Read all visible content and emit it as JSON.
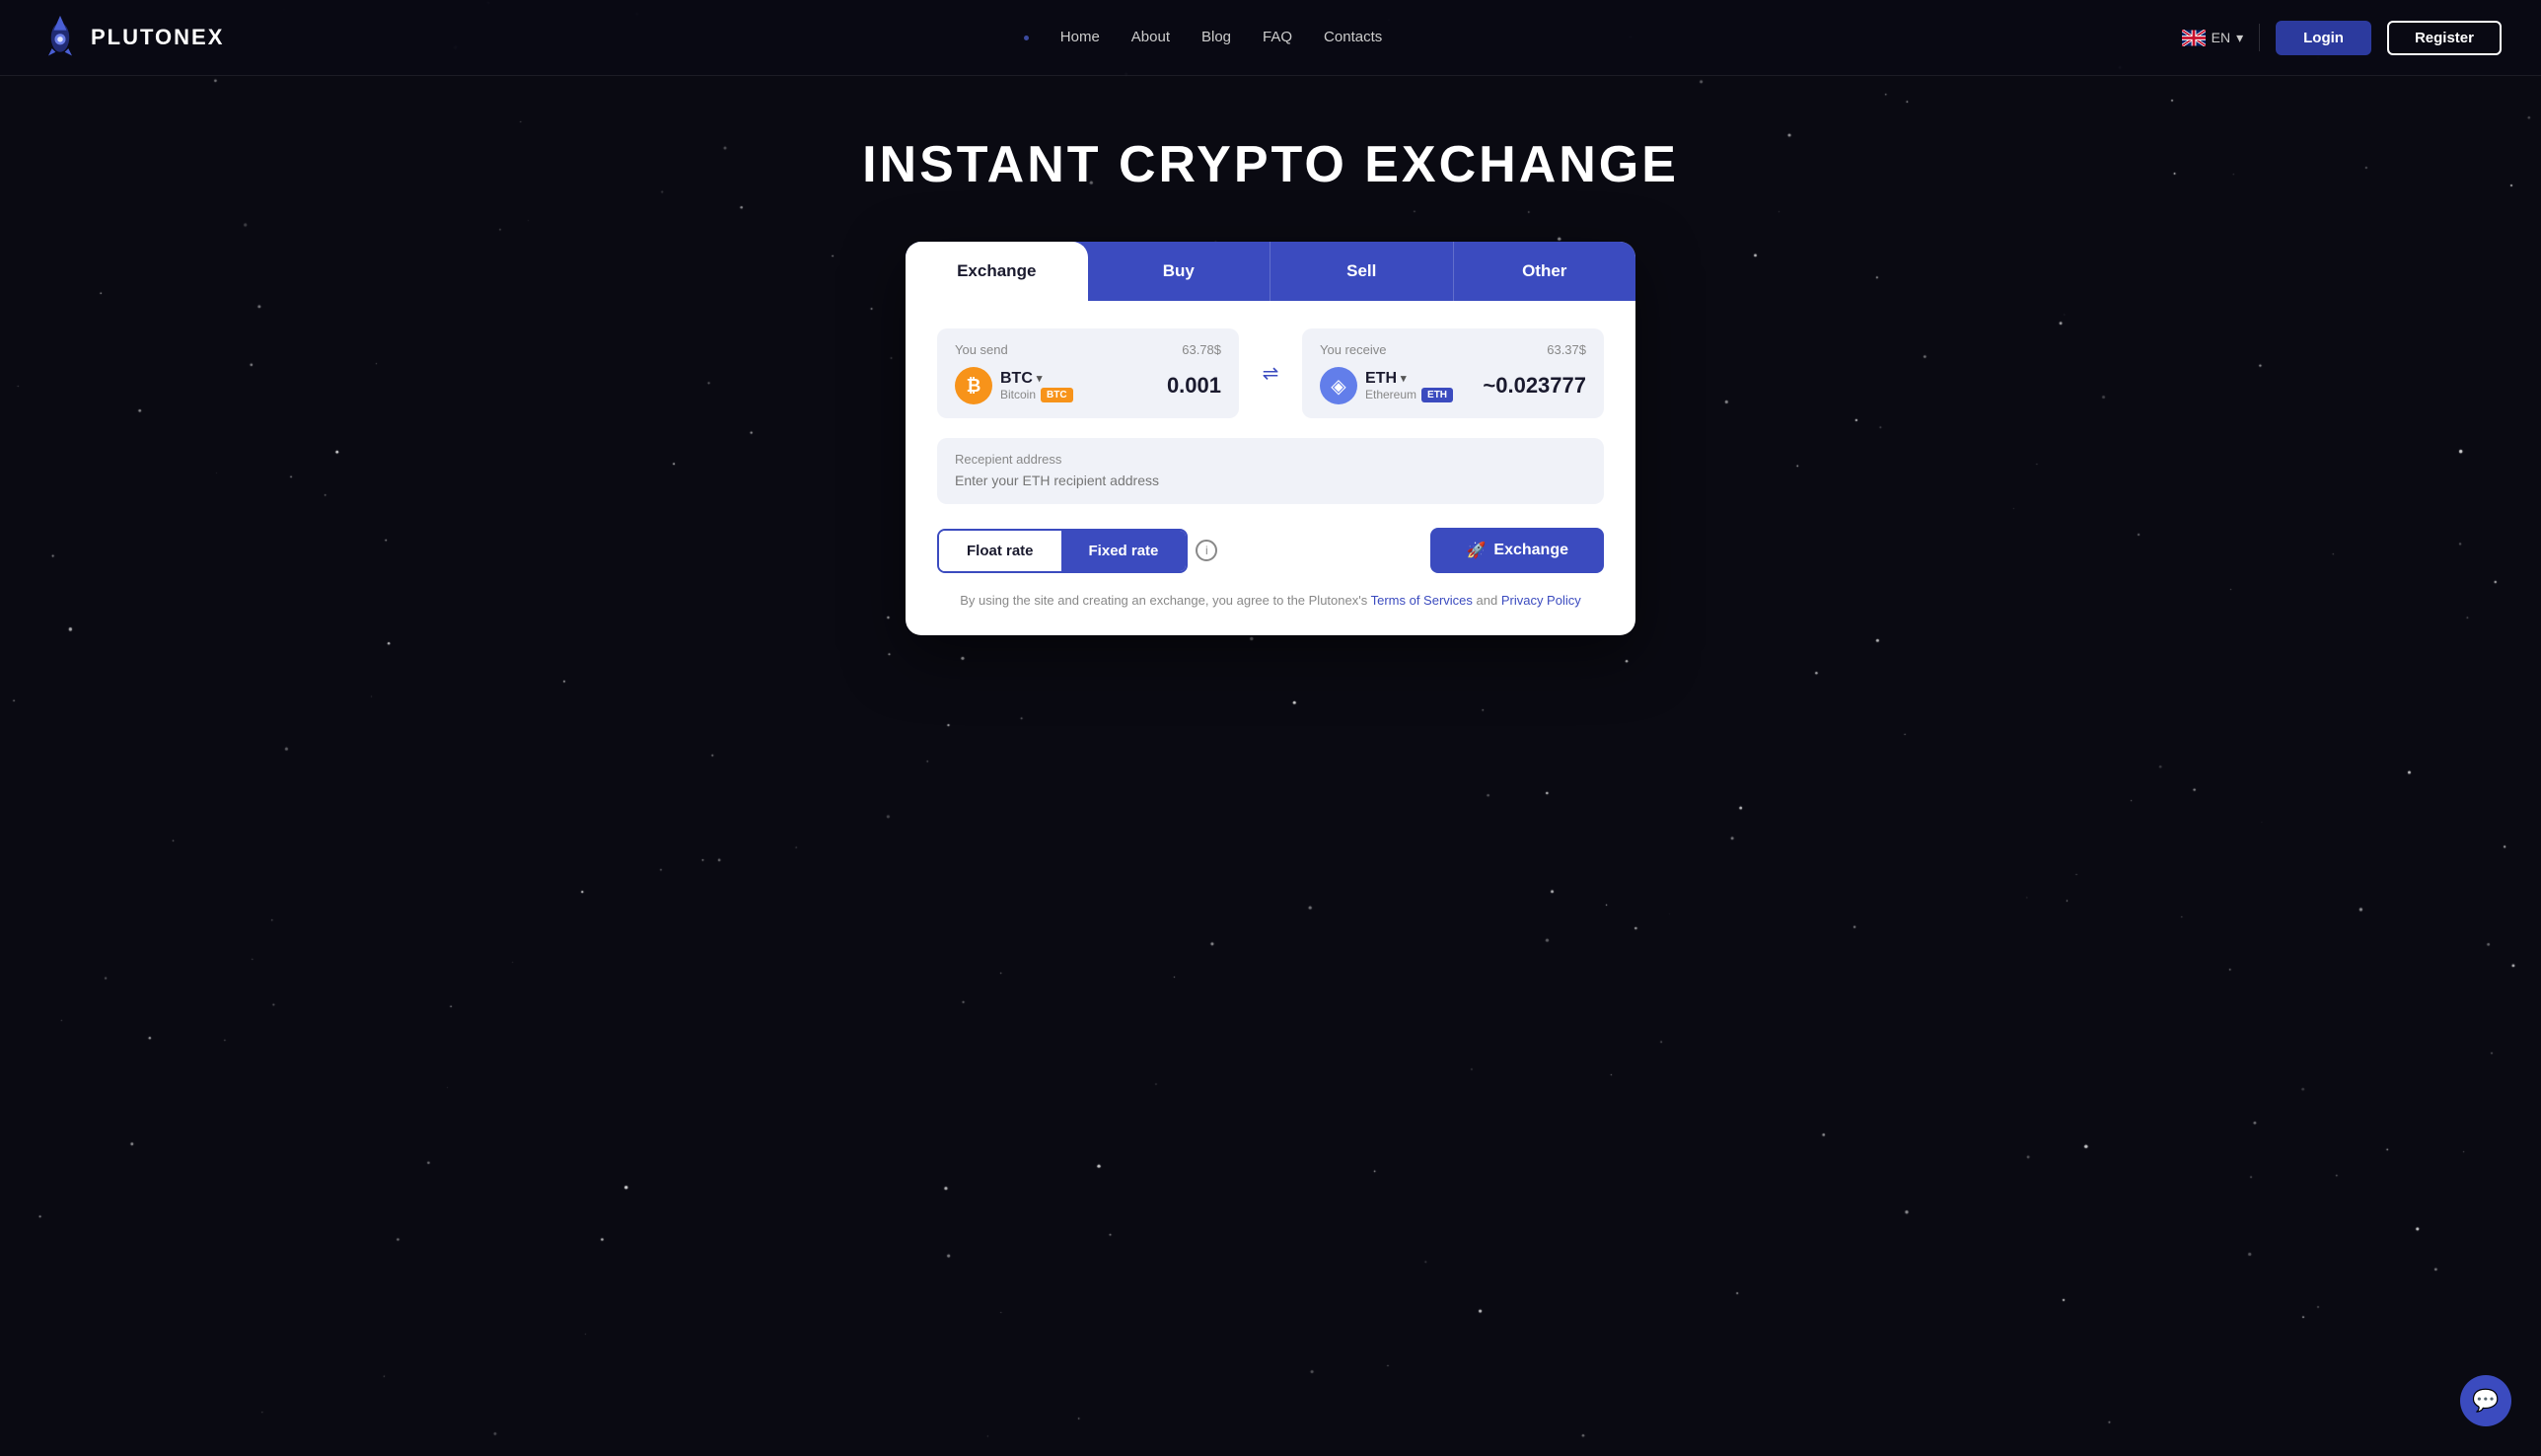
{
  "brand": {
    "name": "PLUTONEX"
  },
  "navbar": {
    "dot": "•",
    "links": [
      {
        "id": "home",
        "label": "Home"
      },
      {
        "id": "about",
        "label": "About"
      },
      {
        "id": "blog",
        "label": "Blog"
      },
      {
        "id": "faq",
        "label": "FAQ"
      },
      {
        "id": "contacts",
        "label": "Contacts"
      }
    ],
    "lang": "EN",
    "login_label": "Login",
    "register_label": "Register"
  },
  "hero": {
    "title": "INSTANT CRYPTO EXCHANGE"
  },
  "exchange_card": {
    "tabs": [
      {
        "id": "exchange",
        "label": "Exchange",
        "active": true
      },
      {
        "id": "buy",
        "label": "Buy"
      },
      {
        "id": "sell",
        "label": "Sell"
      },
      {
        "id": "other",
        "label": "Other"
      }
    ],
    "send": {
      "label": "You send",
      "usd_value": "63.78$",
      "ticker": "BTC",
      "chevron": "▾",
      "full_name": "Bitcoin",
      "tag": "BTC",
      "amount": "0.001"
    },
    "receive": {
      "label": "You receive",
      "usd_value": "63.37$",
      "ticker": "ETH",
      "chevron": "▾",
      "full_name": "Ethereum",
      "tag": "ETH",
      "amount": "~0.023777"
    },
    "recipient": {
      "label": "Recepient address",
      "placeholder": "Enter your ETH recipient address"
    },
    "rates": {
      "float_label": "Float rate",
      "fixed_label": "Fixed rate",
      "info_icon": "i"
    },
    "exchange_button": {
      "emoji": "🚀",
      "label": "Exchange"
    },
    "terms": {
      "prefix": "By using the site and creating an exchange, you agree to the Plutonex's ",
      "terms_label": "Terms of Services",
      "middle": " and ",
      "privacy_label": "Privacy Policy"
    }
  },
  "chat": {
    "icon": "💬"
  }
}
